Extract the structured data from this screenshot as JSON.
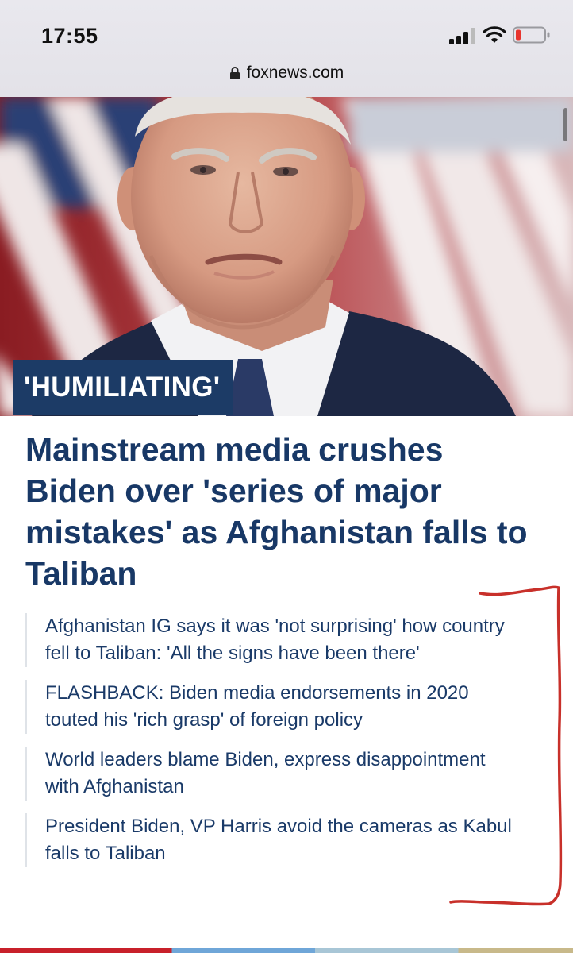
{
  "status_bar": {
    "time": "17:55",
    "icons": [
      "signal-icon",
      "wifi-icon",
      "battery-low-icon"
    ],
    "battery_color": "#e8352e"
  },
  "browser": {
    "url": "foxnews.com",
    "secure": true
  },
  "article": {
    "label": "'HUMILIATING'",
    "headline": "Mainstream media crushes Biden over 'series of major mistakes' as Afghanistan falls to Taliban",
    "related": [
      "Afghanistan IG says it was 'not surprising' how country fell to Taliban: 'All the signs have been there'",
      "FLASHBACK: Biden media endorsements in 2020 touted his 'rich grasp' of foreign policy",
      "World leaders blame Biden, express disappointment with Afghanistan",
      "President Biden, VP Harris avoid the cameras as Kabul falls to Taliban"
    ]
  },
  "colors": {
    "headline": "#183866",
    "label_bg": "#1c3b66",
    "annotation": "#c8302a"
  }
}
